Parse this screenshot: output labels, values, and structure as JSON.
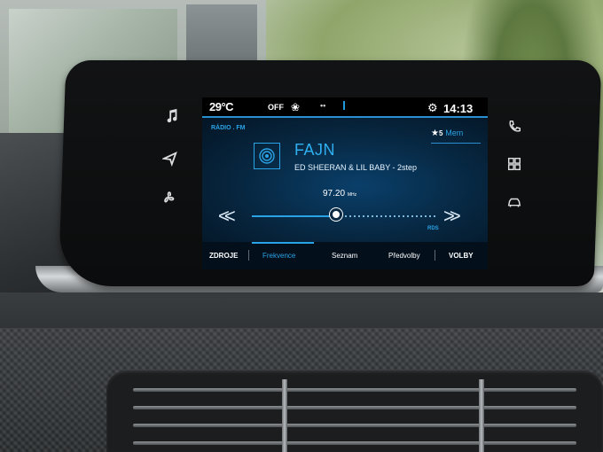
{
  "status": {
    "temperature": "29°C",
    "ac_state": "OFF",
    "fan_icon": "fan-icon",
    "dots": "••",
    "time": "14:13"
  },
  "radio": {
    "source_label": "RÁDIO . FM",
    "station": "FAJN",
    "rds_text": "ED SHEERAN & LIL BABY - 2step",
    "frequency": "97.20",
    "frequency_unit": "MHz",
    "rds_badge": "RDS",
    "tuner_position": 0.45,
    "memory": {
      "count": "5",
      "label": "Mem"
    }
  },
  "tabs": [
    {
      "label": "ZDROJE",
      "selected": false
    },
    {
      "label": "Frekvence",
      "selected": true
    },
    {
      "label": "Seznam",
      "selected": false
    },
    {
      "label": "Předvolby",
      "selected": false
    },
    {
      "label": "VOLBY",
      "selected": false
    }
  ],
  "controls": {
    "left": [
      "music-icon",
      "navigation-icon",
      "fan-icon"
    ],
    "right": [
      "phone-icon",
      "apps-icon",
      "car-icon"
    ],
    "prev_glyph": "<<",
    "next_glyph": ">>"
  },
  "colors": {
    "accent": "#2aa3e6",
    "screen_bg": "#07263f"
  }
}
